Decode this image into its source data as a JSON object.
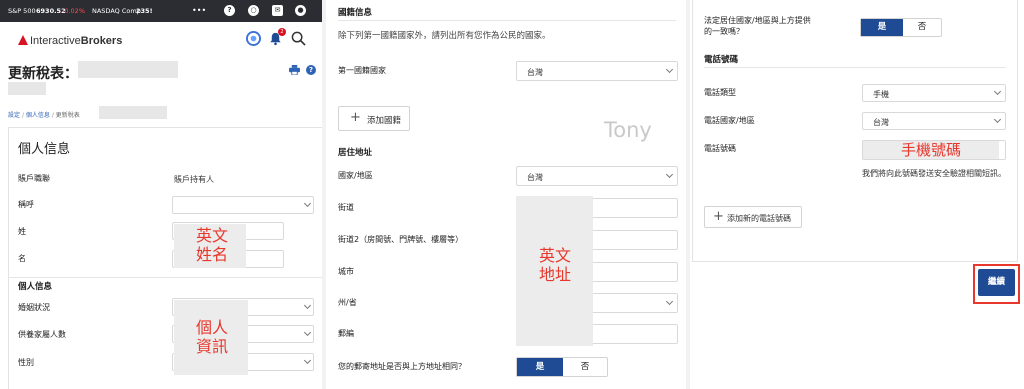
{
  "ticker": {
    "sp_label": "S&P 500",
    "sp_value": "6930.52",
    "sp_change": "-0.02%",
    "nasdaq_label": "NASDAQ Comp",
    "nasdaq_value": "235!",
    "menu": "•••"
  },
  "header": {
    "brand_light": "Interactive",
    "brand_bold": "Brokers",
    "notification_count": "2"
  },
  "page": {
    "title": "更新稅表：",
    "breadcrumb_1": "設定",
    "breadcrumb_2": "個人信息",
    "breadcrumb_3": "更新稅表"
  },
  "personal": {
    "card_title": "個人信息",
    "account_role_label": "賬戶職聯",
    "account_role_value": "賬戶持有人",
    "salutation_label": "稱呼",
    "surname_label": "姓",
    "given_name_label": "名",
    "note_name": "英文\n姓名",
    "section_info": "個人信息",
    "marital_label": "婚姻狀況",
    "dependents_label": "供養家屬人數",
    "gender_label": "性別",
    "note_info": "個人\n資訊"
  },
  "nationality": {
    "section": "國籍信息",
    "description": "除下列第一國籍國家外，請列出所有您作為公民的國家。",
    "first_label": "第一國籍國家",
    "first_value": "台灣",
    "add_button": "添加國籍",
    "watermark": "Tony"
  },
  "address": {
    "section": "居住地址",
    "country_label": "國家/地區",
    "country_value": "台灣",
    "street_label": "街道",
    "street2_label": "街道2（房間號、門牌號、樓層等）",
    "city_label": "城市",
    "state_label": "州/省",
    "postal_label": "郵編",
    "note": "英文\n地址",
    "same_question": "您的郵寄地址是否與上方地址相同？",
    "yes": "是",
    "no": "否"
  },
  "legal": {
    "question": "法定居住國家/地區與上方提供的一致嗎？",
    "yes": "是",
    "no": "否"
  },
  "phone": {
    "section": "電話號碼",
    "type_label": "電話類型",
    "type_value": "手機",
    "country_label": "電話國家/地區",
    "country_value": "台灣",
    "number_label": "電話號碼",
    "number_note": "手機號碼",
    "verify_note": "我們將向此號碼發送安全驗證相關短訊。",
    "add_button": "添加新的電話號碼"
  },
  "footer": {
    "continue_button": "繼續"
  },
  "colors": {
    "primary": "#1f4b95",
    "accent_red": "#d81222",
    "annotation_red": "#e8372c"
  }
}
